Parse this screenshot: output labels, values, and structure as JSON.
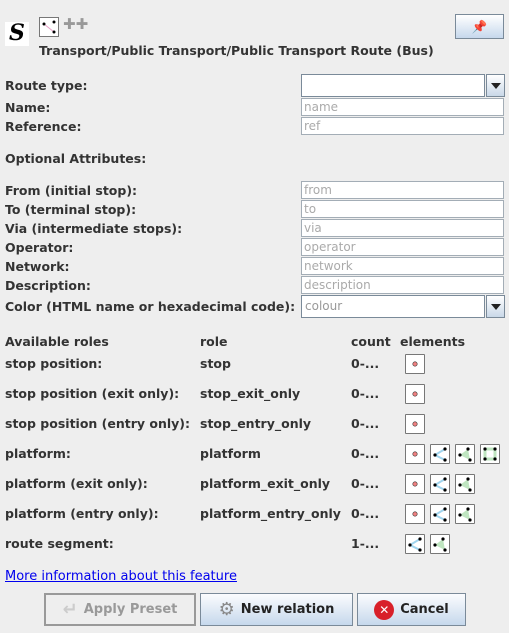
{
  "header": {
    "title": "Transport/Public Transport/Public Transport Route (Bus)",
    "pin_icon": "pin-icon"
  },
  "fields": {
    "route_type": {
      "label": "Route type:",
      "value": ""
    },
    "name": {
      "label": "Name:",
      "placeholder": "name"
    },
    "reference": {
      "label": "Reference:",
      "placeholder": "ref"
    },
    "optional_heading": "Optional Attributes:",
    "from": {
      "label": "From (initial stop):",
      "placeholder": "from"
    },
    "to": {
      "label": "To (terminal stop):",
      "placeholder": "to"
    },
    "via": {
      "label": "Via (intermediate stops):",
      "placeholder": "via"
    },
    "operator": {
      "label": "Operator:",
      "placeholder": "operator"
    },
    "network": {
      "label": "Network:",
      "placeholder": "network"
    },
    "description": {
      "label": "Description:",
      "placeholder": "description"
    },
    "color": {
      "label": "Color (HTML name or hexadecimal code):",
      "placeholder": "colour"
    }
  },
  "roles": {
    "headers": {
      "available": "Available roles",
      "role": "role",
      "count": "count",
      "elements": "elements"
    },
    "rows": [
      {
        "name": "stop position:",
        "role": "stop",
        "count": "0-...",
        "elements": [
          "node"
        ]
      },
      {
        "name": "stop position (exit only):",
        "role": "stop_exit_only",
        "count": "0-...",
        "elements": [
          "node"
        ]
      },
      {
        "name": "stop position (entry only):",
        "role": "stop_entry_only",
        "count": "0-...",
        "elements": [
          "node"
        ]
      },
      {
        "name": "platform:",
        "role": "platform",
        "count": "0-...",
        "elements": [
          "node",
          "way",
          "closedway",
          "multipolygon"
        ]
      },
      {
        "name": "platform (exit only):",
        "role": "platform_exit_only",
        "count": "0-...",
        "elements": [
          "node",
          "way",
          "closedway"
        ]
      },
      {
        "name": "platform (entry only):",
        "role": "platform_entry_only",
        "count": "0-...",
        "elements": [
          "node",
          "way",
          "closedway"
        ]
      },
      {
        "name": "route segment:",
        "role": "",
        "count": "1-...",
        "elements": [
          "way",
          "closedway"
        ]
      }
    ]
  },
  "link": "More information about this feature",
  "buttons": {
    "apply": "Apply Preset",
    "new_relation": "New relation",
    "cancel": "Cancel"
  }
}
